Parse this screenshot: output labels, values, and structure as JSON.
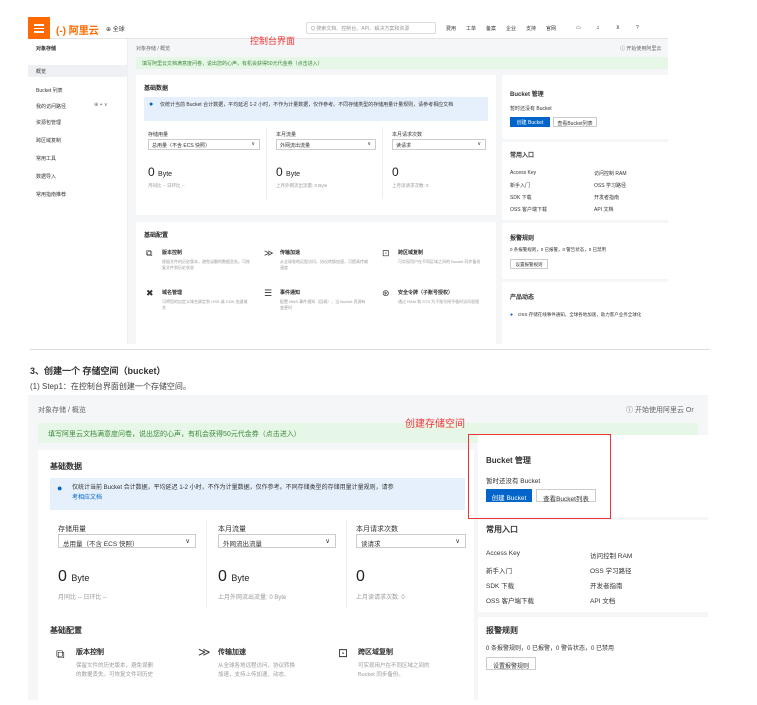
{
  "shot1": {
    "logo": "(-) 阿里云",
    "global": "全球",
    "search_placeholder": "Q 搜索文档、控制台、API、解决方案和资源",
    "nav": [
      "费用",
      "工单",
      "备案",
      "企业",
      "支持",
      "官网"
    ],
    "sidebar": {
      "title": "对象存储",
      "items": [
        "概览",
        "Bucket 列表",
        "我的访问路径",
        "资源包管理",
        "跨区域复制",
        "常用工具",
        "数据导入",
        "常用指南推荐"
      ]
    },
    "breadcrumb": "对象存储 / 概览",
    "help": "开始使用阿里云",
    "annotation": "控制台界面",
    "banner": "填写阿里云文档满意度问卷，说出您的心声，有机会获得50元代金券（点击进入）",
    "basic": {
      "title": "基础数据",
      "note": "仅统计当前 Bucket 合计数据，平均延迟 1-2 小时，不作为计量数据，仅作参考。不同存储类型的存储用量计量规则，请参考相应文档",
      "cols": [
        {
          "label": "存储用量",
          "select": "总用量（不含 ECS 快照）",
          "value": "0",
          "unit": "Byte",
          "sub": "月同比 -- 日环比 --"
        },
        {
          "label": "本月流量",
          "select": "外网流出流量",
          "value": "0",
          "unit": "Byte",
          "sub": "上月外网流出流量: 0 Byte"
        },
        {
          "label": "本月请求次数",
          "select": "读请求",
          "value": "0",
          "unit": "",
          "sub": "上月读请求次数: 0"
        }
      ]
    },
    "config": {
      "title": "基础配置",
      "items": [
        {
          "name": "版本控制",
          "desc": "保留文件的历史版本，避免误删的数据丢失。可恢复文件到历史状态"
        },
        {
          "name": "传输加速",
          "desc": "从全球各地远程访问，协议转换加速，可提高传输速度"
        },
        {
          "name": "跨区域复制",
          "desc": "可实现用户在不同区域之间的 Bucket 同步备份"
        },
        {
          "name": "域名管理",
          "desc": "可将您的自定义域名绑定到 OSS 或 CDN 加速域名"
        },
        {
          "name": "事件通知",
          "desc": "配置 MNS 事件通知（回调），当 Bucket 资源有变更时"
        },
        {
          "name": "安全令牌（子账号授权）",
          "desc": "通过 RAM 和 STS 为子账号授予临时访问权限"
        }
      ]
    },
    "bucket_mgmt": {
      "title": "Bucket 管理",
      "empty": "暂时还没有 Bucket",
      "create": "创建 Bucket",
      "list": "查看Bucket列表"
    },
    "common": {
      "title": "常用入口",
      "links": [
        "Access Key",
        "访问控制 RAM",
        "新手入门",
        "OSS 学习路径",
        "SDK 下载",
        "开发者指南",
        "OSS 客户端下载",
        "API 文档"
      ]
    },
    "alarm": {
      "title": "报警规则",
      "text": "0 条报警规则，0 已报警，0 警告状态，0 已禁用",
      "button": "设置报警规则"
    },
    "product": {
      "title": "产品动态",
      "item": "OSS 存储在线事件通知，全球各地加速，助力客户业务全球化"
    }
  },
  "step_heading": "3、创建一个 存储空间（bucket）",
  "step_sub": "(1) Step1：在控制台界面创建一个存储空间。",
  "shot2": {
    "breadcrumb": "对象存储 / 概览",
    "help": "开始使用阿里云 Or",
    "annotation": "创建存储空间",
    "banner": "填写阿里云文档满意度问卷，说出您的心声，有机会获得50元代金券（点击进入）",
    "basic": {
      "title": "基础数据",
      "note_line1": "仅统计当前 Bucket 合计数据，平均延迟 1-2 小时，不作为计量数据，仅作参考。不同存储类型的存储用量计量规则，请参",
      "note_line2": "考相应文档",
      "cols": [
        {
          "label": "存储用量",
          "select": "总用量（不含 ECS 快照）",
          "value": "0",
          "unit": "Byte",
          "sub": "月同比 -- 日环比 --"
        },
        {
          "label": "本月流量",
          "select": "外网流出流量",
          "value": "0",
          "unit": "Byte",
          "sub": "上月外网流出流量: 0 Byte"
        },
        {
          "label": "本月请求次数",
          "select": "读请求",
          "value": "0",
          "unit": "",
          "sub": "上月读请求次数: 0"
        }
      ]
    },
    "config": {
      "title": "基础配置",
      "items": [
        {
          "name": "版本控制",
          "desc1": "保留文件的历史版本，避免误删",
          "desc2": "的数据丢失。可恢复文件到历史"
        },
        {
          "name": "传输加速",
          "desc1": "从全球各地远程访问，协议转换",
          "desc2": "加速，支持上传加速、动态、"
        },
        {
          "name": "跨区域复制",
          "desc1": "可实现用户在不同区域之间的",
          "desc2": "Bucket 同步备份。"
        }
      ]
    },
    "bucket_mgmt": {
      "title": "Bucket 管理",
      "empty": "暂时还没有 Bucket",
      "create": "创建 Bucket",
      "list": "查看Bucket列表"
    },
    "common": {
      "title": "常用入口",
      "links": [
        "Access Key",
        "访问控制 RAM",
        "新手入门",
        "OSS 学习路径",
        "SDK 下载",
        "开发者指南",
        "OSS 客户端下载",
        "API 文档"
      ]
    },
    "alarm": {
      "title": "报警规则",
      "text": "0 条报警规则，0 已报警，0 警告状态，0 已禁用",
      "button": "设置报警规则"
    }
  },
  "colors": {
    "accent": "#ff6a00",
    "primary": "#0064c8",
    "annotation": "#ee3333",
    "banner_bg": "#e7f7e7"
  }
}
